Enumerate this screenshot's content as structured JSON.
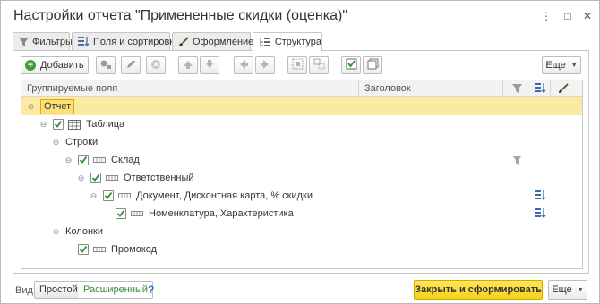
{
  "window": {
    "title": "Настройки отчета \"Примененные скидки (оценка)\"",
    "controls": {
      "menu": "⋮",
      "maximize": "□",
      "close": "✕"
    }
  },
  "tabs": [
    {
      "label": "Фильтры",
      "icon": "filter-icon",
      "active": false
    },
    {
      "label": "Поля и сортировки",
      "icon": "fields-sort-icon",
      "active": false
    },
    {
      "label": "Оформление",
      "icon": "brush-icon",
      "active": false
    },
    {
      "label": "Структура",
      "icon": "structure-icon",
      "active": true
    }
  ],
  "toolbar": {
    "add_label": "Добавить",
    "more_label": "Еще",
    "icons": [
      "add-group-icon",
      "edit-icon",
      "delete-icon",
      "move-up-icon",
      "move-down-icon",
      "move-left-icon",
      "move-right-icon",
      "group-icon",
      "ungroup-icon",
      "check-all-icon",
      "uncheck-all-icon"
    ]
  },
  "grid": {
    "columns": {
      "fields": "Группируемые поля",
      "header": "Заголовок",
      "filter_icon": "filter-icon",
      "sort_icon": "sort-icon",
      "format_icon": "brush-icon"
    },
    "rows": [
      {
        "label": "Отчет",
        "selected": true,
        "expander": "⊖",
        "checkbox": false,
        "icon": ""
      },
      {
        "label": "Таблица",
        "selected": false,
        "expander": "⊖",
        "checkbox": true,
        "checked": true,
        "icon": "table-icon"
      },
      {
        "label": "Строки",
        "selected": false,
        "expander": "⊖",
        "checkbox": false,
        "icon": ""
      },
      {
        "label": "Склад",
        "selected": false,
        "expander": "⊖",
        "checkbox": true,
        "checked": true,
        "icon": "field-icon",
        "has_filter": true
      },
      {
        "label": "Ответственный",
        "selected": false,
        "expander": "⊖",
        "checkbox": true,
        "checked": true,
        "icon": "field-icon"
      },
      {
        "label": "Документ, Дисконтная карта, % скидки",
        "selected": false,
        "expander": "⊖",
        "checkbox": true,
        "checked": true,
        "icon": "field-icon",
        "has_sort": true
      },
      {
        "label": "Номенклатура, Характеристика",
        "selected": false,
        "expander": "",
        "checkbox": true,
        "checked": true,
        "icon": "field-icon",
        "has_sort": true
      },
      {
        "label": "Колонки",
        "selected": false,
        "expander": "⊖",
        "checkbox": false,
        "icon": ""
      },
      {
        "label": "Промокод",
        "selected": false,
        "expander": "",
        "checkbox": true,
        "checked": true,
        "icon": "field-icon"
      }
    ]
  },
  "footer": {
    "view_label": "Вид:",
    "simple_label": "Простой",
    "advanced_label": "Расширенный",
    "help_label": "?",
    "primary_label": "Закрыть и сформировать",
    "more_label": "Еще"
  },
  "colors": {
    "accent_green": "#3c9d3c",
    "selected_row": "#fbeaa0",
    "primary_button": "#f4d21c"
  }
}
